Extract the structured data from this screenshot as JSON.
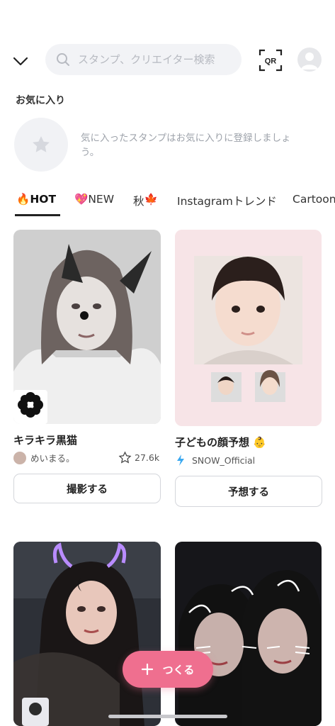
{
  "search": {
    "placeholder": "スタンプ、クリエイター検索",
    "qr_label": "QR"
  },
  "favorites": {
    "title": "お気に入り",
    "empty_message": "気に入ったスタンプはお気に入りに登録しましょう。"
  },
  "tabs": [
    {
      "emoji": "🔥",
      "label": "HOT",
      "active": true
    },
    {
      "emoji": "💖",
      "label": "NEW",
      "active": false
    },
    {
      "emoji": "🍁",
      "label": "秋",
      "active": false
    },
    {
      "emoji": "",
      "label": "Instagramトレンド",
      "active": false
    },
    {
      "emoji": "",
      "label": "Cartoon",
      "active": false
    }
  ],
  "cards": [
    {
      "title": "キラキラ黒猫",
      "creator": "めいまる。",
      "likes": "27.6k",
      "button": "撮影する"
    },
    {
      "title": "子どもの顔予想 👶",
      "creator": "SNOW_Official",
      "button": "予想する"
    }
  ],
  "fab": {
    "label": "つくる"
  },
  "colors": {
    "accent": "#ef6f8f",
    "verified": "#3aa8f0"
  }
}
